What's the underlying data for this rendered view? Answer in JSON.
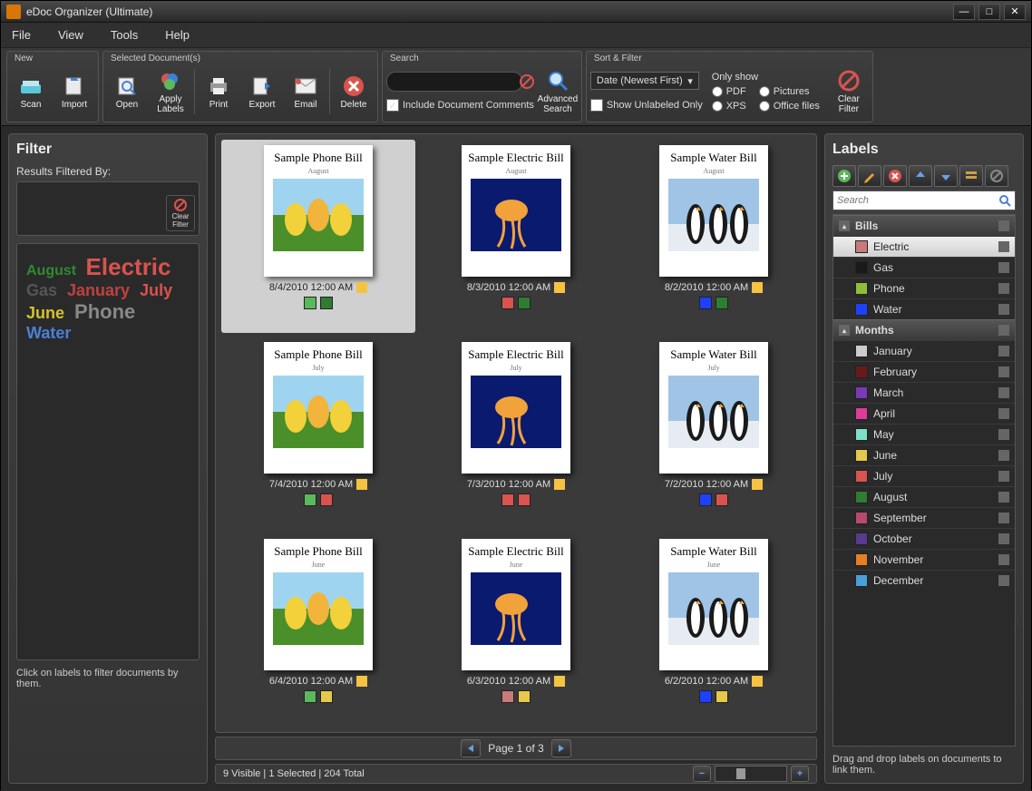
{
  "title": "eDoc Organizer (Ultimate)",
  "menu": {
    "file": "File",
    "view": "View",
    "tools": "Tools",
    "help": "Help"
  },
  "toolbar": {
    "groups": {
      "new": "New",
      "selected": "Selected Document(s)",
      "search": "Search",
      "sortfilter": "Sort & Filter"
    },
    "scan": "Scan",
    "import": "Import",
    "open": "Open",
    "apply_labels": "Apply Labels",
    "print": "Print",
    "export": "Export",
    "email": "Email",
    "delete": "Delete",
    "include_comments": "Include Document Comments",
    "advanced_search": "Advanced Search",
    "sort_dropdown": "Date (Newest First)",
    "show_unlabeled": "Show Unlabeled Only",
    "only_show": "Only show",
    "pdf": "PDF",
    "pictures": "Pictures",
    "xps": "XPS",
    "office": "Office files",
    "clear_filter": "Clear Filter"
  },
  "filter_panel": {
    "title": "Filter",
    "results_filtered": "Results Filtered By:",
    "clear_filter": "Clear Filter",
    "hint": "Click on labels to filter documents by them.",
    "tags": [
      {
        "text": "August",
        "color": "#2e8b2e",
        "size": "16px"
      },
      {
        "text": "Electric",
        "color": "#d9534f",
        "size": "26px"
      },
      {
        "text": "Gas",
        "color": "#555555",
        "size": "18px"
      },
      {
        "text": "January",
        "color": "#c04040",
        "size": "18px"
      },
      {
        "text": "July",
        "color": "#d9534f",
        "size": "18px"
      },
      {
        "text": "June",
        "color": "#d4c22a",
        "size": "18px"
      },
      {
        "text": "Phone",
        "color": "#888888",
        "size": "22px"
      },
      {
        "text": "Water",
        "color": "#4a7fd9",
        "size": "18px"
      }
    ]
  },
  "documents": [
    {
      "title": "Sample Phone Bill",
      "month": "August",
      "date": "8/4/2010 12:00 AM",
      "img": "tulips",
      "labels": [
        "#5cb85c",
        "#2e7d32"
      ],
      "selected": true
    },
    {
      "title": "Sample Electric Bill",
      "month": "August",
      "date": "8/3/2010 12:00 AM",
      "img": "jelly",
      "labels": [
        "#d9534f",
        "#2e7d32"
      ]
    },
    {
      "title": "Sample Water Bill",
      "month": "August",
      "date": "8/2/2010 12:00 AM",
      "img": "penguins",
      "labels": [
        "#1e40ff",
        "#2e7d32"
      ]
    },
    {
      "title": "Sample Phone Bill",
      "month": "July",
      "date": "7/4/2010 12:00 AM",
      "img": "tulips",
      "labels": [
        "#5cb85c",
        "#d9534f"
      ]
    },
    {
      "title": "Sample Electric Bill",
      "month": "July",
      "date": "7/3/2010 12:00 AM",
      "img": "jelly",
      "labels": [
        "#d9534f",
        "#d9534f"
      ]
    },
    {
      "title": "Sample Water Bill",
      "month": "July",
      "date": "7/2/2010 12:00 AM",
      "img": "penguins",
      "labels": [
        "#1e40ff",
        "#d9534f"
      ]
    },
    {
      "title": "Sample Phone Bill",
      "month": "June",
      "date": "6/4/2010 12:00 AM",
      "img": "tulips",
      "labels": [
        "#5cb85c",
        "#e6c84a"
      ]
    },
    {
      "title": "Sample Electric Bill",
      "month": "June",
      "date": "6/3/2010 12:00 AM",
      "img": "jelly",
      "labels": [
        "#c97a7a",
        "#e6c84a"
      ]
    },
    {
      "title": "Sample Water Bill",
      "month": "June",
      "date": "6/2/2010 12:00 AM",
      "img": "penguins",
      "labels": [
        "#1e40ff",
        "#e6c84a"
      ]
    }
  ],
  "pagination": {
    "text": "Page 1 of 3"
  },
  "status": {
    "text": "9 Visible | 1 Selected | 204 Total"
  },
  "labels_panel": {
    "title": "Labels",
    "search_placeholder": "Search",
    "hint": "Drag and drop labels on documents to link them.",
    "groups": [
      {
        "name": "Bills",
        "items": [
          {
            "name": "Electric",
            "color": "#c97a7a",
            "selected": true
          },
          {
            "name": "Gas",
            "color": "#1a1a1a"
          },
          {
            "name": "Phone",
            "color": "#8fbf3a"
          },
          {
            "name": "Water",
            "color": "#1e40ff"
          }
        ]
      },
      {
        "name": "Months",
        "items": [
          {
            "name": "January",
            "color": "#cccccc"
          },
          {
            "name": "February",
            "color": "#6b1a1a"
          },
          {
            "name": "March",
            "color": "#7a3ab8"
          },
          {
            "name": "April",
            "color": "#e03a9a"
          },
          {
            "name": "May",
            "color": "#7de0c8"
          },
          {
            "name": "June",
            "color": "#e6c84a"
          },
          {
            "name": "July",
            "color": "#d9534f"
          },
          {
            "name": "August",
            "color": "#2e7d32"
          },
          {
            "name": "September",
            "color": "#b84a6b"
          },
          {
            "name": "October",
            "color": "#5a3a8f"
          },
          {
            "name": "November",
            "color": "#e67e22"
          },
          {
            "name": "December",
            "color": "#4a9fd9"
          }
        ]
      }
    ]
  }
}
